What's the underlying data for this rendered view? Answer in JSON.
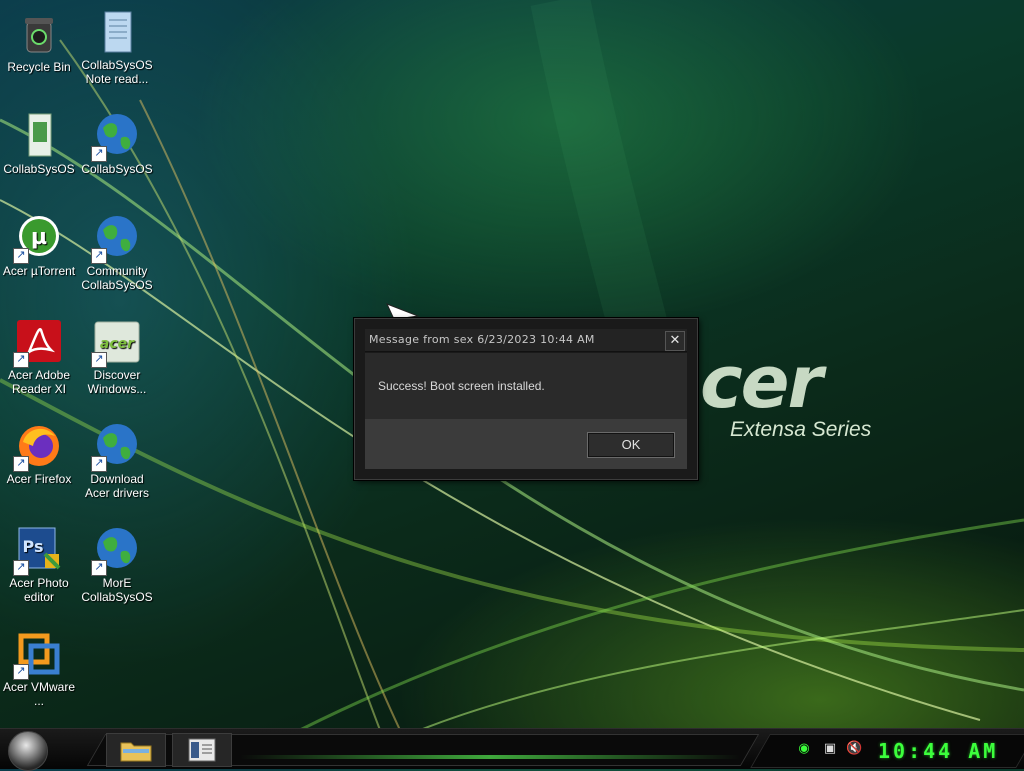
{
  "wallpaper": {
    "brand_logo": "cer",
    "brand_sub": "Extensa Series"
  },
  "desktop_icons": [
    {
      "label": "Recycle Bin",
      "icon": "recycle-bin-icon"
    },
    {
      "label": "CollabSysOS Note read...",
      "icon": "notepad-icon"
    },
    {
      "label": "CollabSysOS",
      "icon": "app-icon"
    },
    {
      "label": "CollabSysOS",
      "icon": "globe-icon"
    },
    {
      "label": "Acer µTorrent",
      "icon": "utorrent-icon"
    },
    {
      "label": "Community CollabSysOS",
      "icon": "globe-icon"
    },
    {
      "label": "Acer Adobe Reader XI",
      "icon": "adobe-reader-icon"
    },
    {
      "label": "Discover Windows...",
      "icon": "acer-discover-icon"
    },
    {
      "label": "Acer Firefox",
      "icon": "firefox-icon"
    },
    {
      "label": "Download Acer drivers",
      "icon": "globe-icon"
    },
    {
      "label": "Acer Photo editor",
      "icon": "photoshop-icon"
    },
    {
      "label": "MorE CollabSysOS",
      "icon": "globe-icon"
    },
    {
      "label": "Acer VMware ...",
      "icon": "vmware-icon"
    }
  ],
  "dialog": {
    "title": "Message from sex 6/23/2023 10:44 AM",
    "close_label": "✕",
    "message": "Success! Boot screen installed.",
    "ok_label": "OK"
  },
  "taskbar": {
    "clock": "10:44 AM",
    "tray_icons": [
      "network-icon",
      "volume-muted-icon"
    ]
  },
  "colors": {
    "clock": "#3cff3c",
    "dialog_bg": "#1a1a1a",
    "accent_green": "#3fa83c"
  }
}
